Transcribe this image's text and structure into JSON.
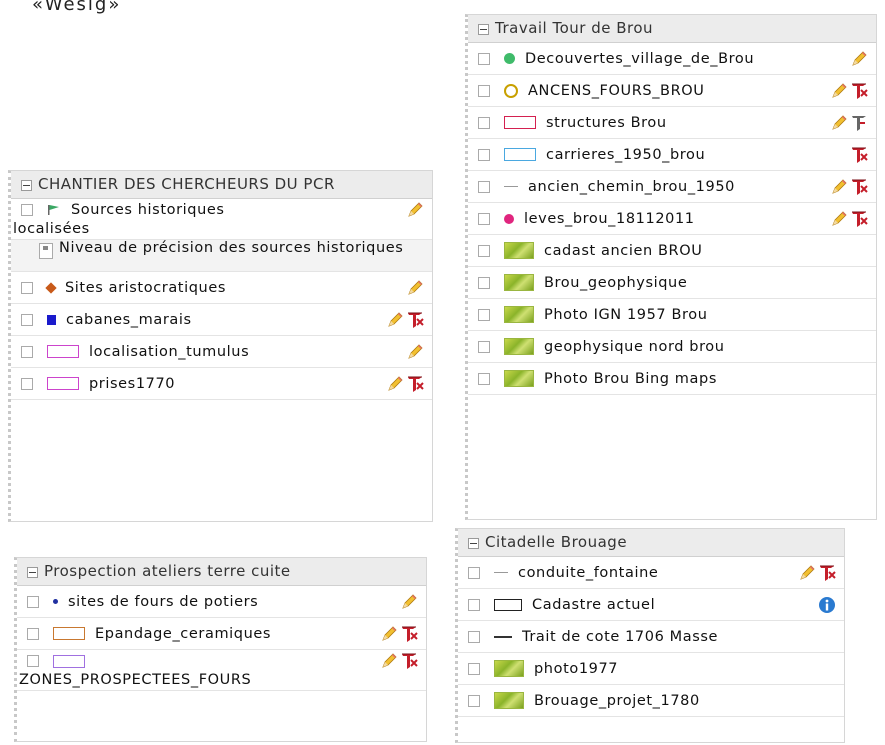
{
  "top_text": "«Wesig»",
  "panels": {
    "travail": {
      "title": "Travail Tour de Brou",
      "rows": [
        {
          "label": "Decouvertes_village_de_Brou",
          "symbol": "green-dot",
          "actions": [
            "pencil-icon"
          ]
        },
        {
          "label": "ANCENS_FOURS_BROU",
          "symbol": "yellow-ring",
          "actions": [
            "pencil-icon",
            "tool-icon"
          ]
        },
        {
          "label": "structures Brou",
          "symbol": "red-rect",
          "actions": [
            "pencil-icon",
            "tool-grey-icon"
          ]
        },
        {
          "label": "carrieres_1950_brou",
          "symbol": "blue-rect",
          "actions": [
            "tool-icon"
          ]
        },
        {
          "label": "ancien_chemin_brou_1950",
          "symbol": "grey-line",
          "actions": [
            "pencil-icon",
            "tool-icon"
          ]
        },
        {
          "label": "leves_brou_18112011",
          "symbol": "pink-dot",
          "actions": [
            "pencil-icon",
            "tool-icon"
          ]
        },
        {
          "label": "cadast ancien BROU",
          "symbol": "raster",
          "actions": []
        },
        {
          "label": "Brou_geophysique",
          "symbol": "raster",
          "actions": []
        },
        {
          "label": "Photo IGN 1957 Brou",
          "symbol": "raster",
          "actions": []
        },
        {
          "label": "geophysique nord brou",
          "symbol": "raster",
          "actions": []
        },
        {
          "label": "Photo Brou Bing maps",
          "symbol": "raster",
          "actions": []
        }
      ]
    },
    "chantier": {
      "title": "CHANTIER DES CHERCHEURS DU PCR",
      "rows": [
        {
          "label": "Sources historiques",
          "label2": "localisées",
          "symbol": "flag",
          "actions": [
            "pencil-icon"
          ]
        },
        {
          "label": "Niveau de précision des sources historiques",
          "symbol": "legend-mini",
          "sub": true
        },
        {
          "label": "Sites aristocratiques",
          "symbol": "orange-diamond",
          "actions": [
            "pencil-icon"
          ]
        },
        {
          "label": "cabanes_marais",
          "symbol": "blue-square",
          "actions": [
            "pencil-icon",
            "tool-icon"
          ]
        },
        {
          "label": "localisation_tumulus",
          "symbol": "pink-rect",
          "actions": [
            "pencil-icon"
          ]
        },
        {
          "label": "prises1770",
          "symbol": "pink-rect",
          "actions": [
            "pencil-icon",
            "tool-icon"
          ]
        }
      ]
    },
    "prospection": {
      "title": "Prospection ateliers terre cuite",
      "rows": [
        {
          "label": "sites de fours de potiers",
          "symbol": "small-dot",
          "actions": [
            "pencil-icon"
          ]
        },
        {
          "label": "Epandage_ceramiques",
          "symbol": "orange-rect",
          "actions": [
            "pencil-icon",
            "tool-icon"
          ]
        },
        {
          "label": "",
          "label2": "ZONES_PROSPECTEES_FOURS",
          "symbol": "purple-rect",
          "actions": [
            "pencil-icon",
            "tool-icon"
          ]
        }
      ]
    },
    "citadelle": {
      "title": "Citadelle Brouage",
      "rows": [
        {
          "label": "conduite_fontaine",
          "symbol": "grey-line",
          "actions": [
            "pencil-icon",
            "tool-icon"
          ]
        },
        {
          "label": "Cadastre actuel",
          "symbol": "black-rect",
          "actions": [
            "info-icon"
          ]
        },
        {
          "label": "Trait de cote 1706 Masse",
          "symbol": "dark-line",
          "actions": []
        },
        {
          "label": "photo1977",
          "symbol": "raster",
          "actions": []
        },
        {
          "label": "Brouage_projet_1780",
          "symbol": "raster",
          "actions": []
        }
      ]
    }
  },
  "colors": {
    "header_bg": "#ececec",
    "border": "#d6d6d6",
    "pencil": "#e8b030",
    "tool_red": "#c41e2a",
    "info_blue": "#2a7ad0"
  }
}
